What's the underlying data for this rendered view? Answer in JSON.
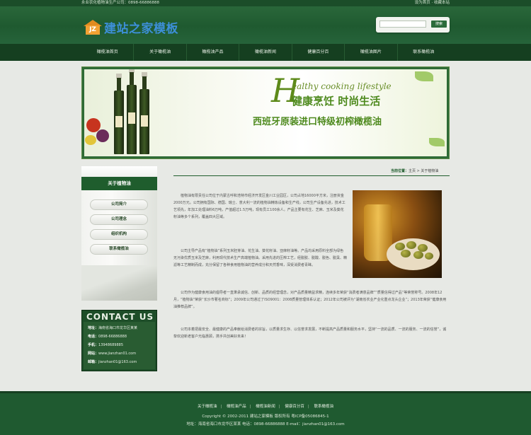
{
  "header": {
    "hotline": "永业农化植物油生产公司：0898-66886888",
    "top_links": "设为首页 · 收藏本站",
    "logo_mark": "JZ",
    "logo_text": "建站之家模板",
    "search_placeholder": "",
    "search_button": "搜索"
  },
  "nav": {
    "items": [
      "橄榄油首页",
      "关于橄榄油",
      "橄榄油产品",
      "橄榄油新闻",
      "健康百分百",
      "橄榄油图片",
      "联系橄榄油"
    ]
  },
  "banner": {
    "h_letter": "H",
    "english": "ealthy cooking lifestyle",
    "cn_line1": "健康烹饪 时尚生活",
    "cn_line2": "西班牙原装进口特级初榨橄榄油"
  },
  "sidebar": {
    "title": "关于植物油",
    "menu": [
      "公司简介",
      "公司理念",
      "组织机构",
      "联系橄榄油"
    ]
  },
  "contact": {
    "heading": "CONTACT US",
    "address_label": "地址：",
    "address": "海南省海口市龙华区某某",
    "phone_label": "电话：",
    "phone": "0898-66886888",
    "mobile_label": "手机：",
    "mobile": "13948689885",
    "web_label": "网站：",
    "web": "www.jianzhan01.com",
    "email_label": "邮箱：",
    "email": "jianzhan01@163.com"
  },
  "breadcrumb": {
    "label": "当前位置：",
    "path": "主页 > 关于植物油"
  },
  "article": {
    "p1": "植物油有限责任公司位于内蒙古呼和浩特市经济开发区金川工业园区，公司占地16000平方米，注册资金2000万元。公司拥有国际、德国、瑞士、意大利一流的植物油精炼设备和生产线，公司生产设备先进，技术工艺领先，年加工处理油料6万吨，产值超过1.5万吨，现有员工100余人。产品主要有花生、芝麻、玉米及葵花籽油等多个系列，覆盖四大区域。",
    "p2": "公司主导产品有“植物油”系列玉米胚芽油、花生油、葵花籽油、亚麻籽油等。产品均采用原料全部为绿色无污染优质玉米及芝麻，利用现代技术生产高端植物油。采用先进的压榨工艺，经脱胶、脱酸、脱色、脱臭、精滤等工艺精制而成，充分保留了各种食用植物油的营养成分和天然香味，深受消费者青睐。",
    "p3": "公司作为健康食用油的倡导者一直秉承诚信、创新、品质的经营理念，对产品质量精益求精，连续多年荣获“消费者满意品牌”“质量信得过产品”等荣誉称号。2008年12月，“植物油”荣获“长沙市著名商标”；2009年公司通过了ISO9001：2008质量管理体系认证；2012年公司被评为“湖南省农业产业化重点龙头企业”；2013年荣获“健康食用油推荐品牌”。",
    "p4": "公司本着把最安全、最健康的产品奉献给消费者的宗旨，以质量求生存、以信誉求发展，不断提高产品质量和服务水平，坚持“一流的品质、一流的服务、一流的信誉”，诚挚欢迎新老客户光临惠顾，携手共创美好未来！"
  },
  "footer": {
    "links": [
      "关于橄榄油",
      "橄榄油产品",
      "橄榄油新闻",
      "健康百分百",
      "联系橄榄油"
    ],
    "copyright": "Copyright © 2002-2011 建站之家模板 版权所有 粤ICP备05086845-1",
    "address": "地址：海南省海口市龙华区某某 电话：0898-66886888 E-mail：jianzhan01@163.com"
  },
  "colors": {
    "brand_green": "#1f5a30",
    "nav_dark": "#153f20",
    "accent_olive": "#5d8a1a",
    "logo_blue": "#3d8fd8",
    "logo_orange": "#f2a133"
  }
}
